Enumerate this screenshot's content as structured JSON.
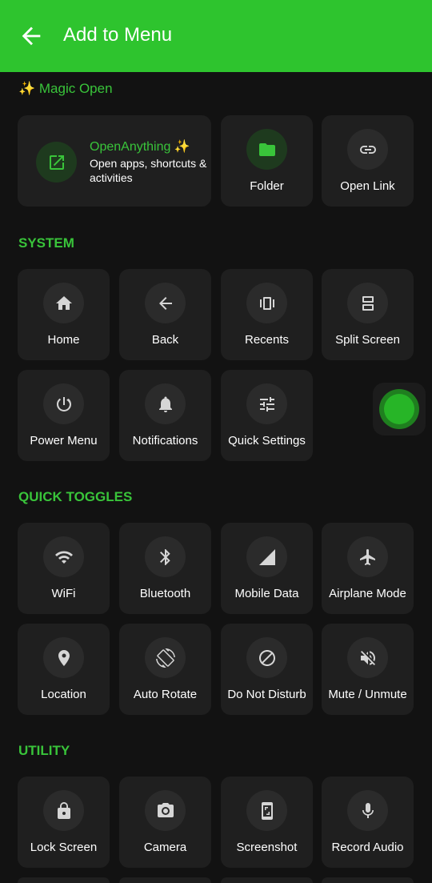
{
  "appbar": {
    "title": "Add to Menu",
    "back_icon": "arrow-left-icon",
    "bg_color": "#2ec42e"
  },
  "accent_color": "#39c43a",
  "magic": {
    "title": "✨ Magic Open",
    "open_anything": {
      "title": "OpenAnything ✨",
      "subtitle": "Open apps, shortcuts & activities",
      "icon": "open-external-icon"
    },
    "folder": {
      "label": "Folder",
      "icon": "folder-icon"
    },
    "open_link": {
      "label": "Open Link",
      "icon": "link-icon"
    }
  },
  "system": {
    "title": "SYSTEM",
    "items": [
      {
        "label": "Home",
        "icon": "home-icon"
      },
      {
        "label": "Back",
        "icon": "back-arrow-icon"
      },
      {
        "label": "Recents",
        "icon": "recents-icon"
      },
      {
        "label": "Split Screen",
        "icon": "split-screen-icon"
      },
      {
        "label": "Power Menu",
        "icon": "power-icon"
      },
      {
        "label": "Notifications",
        "icon": "bell-icon"
      },
      {
        "label": "Quick Settings",
        "icon": "sliders-icon"
      }
    ]
  },
  "quick_toggles": {
    "title": "QUICK TOGGLES",
    "items": [
      {
        "label": "WiFi",
        "icon": "wifi-icon"
      },
      {
        "label": "Bluetooth",
        "icon": "bluetooth-icon"
      },
      {
        "label": "Mobile Data",
        "icon": "signal-icon"
      },
      {
        "label": "Airplane Mode",
        "icon": "airplane-icon"
      },
      {
        "label": "Location",
        "icon": "location-pin-icon"
      },
      {
        "label": "Auto Rotate",
        "icon": "rotate-icon"
      },
      {
        "label": "Do Not Disturb",
        "icon": "do-not-disturb-icon"
      },
      {
        "label": "Mute / Unmute",
        "icon": "volume-off-icon"
      }
    ]
  },
  "utility": {
    "title": "UTILITY",
    "items": [
      {
        "label": "Lock Screen",
        "icon": "lock-icon"
      },
      {
        "label": "Camera",
        "icon": "camera-icon"
      },
      {
        "label": "Screenshot",
        "icon": "screenshot-icon"
      },
      {
        "label": "Record Audio",
        "icon": "microphone-icon"
      }
    ]
  },
  "floating_button": {
    "icon": "floating-dot-icon"
  }
}
